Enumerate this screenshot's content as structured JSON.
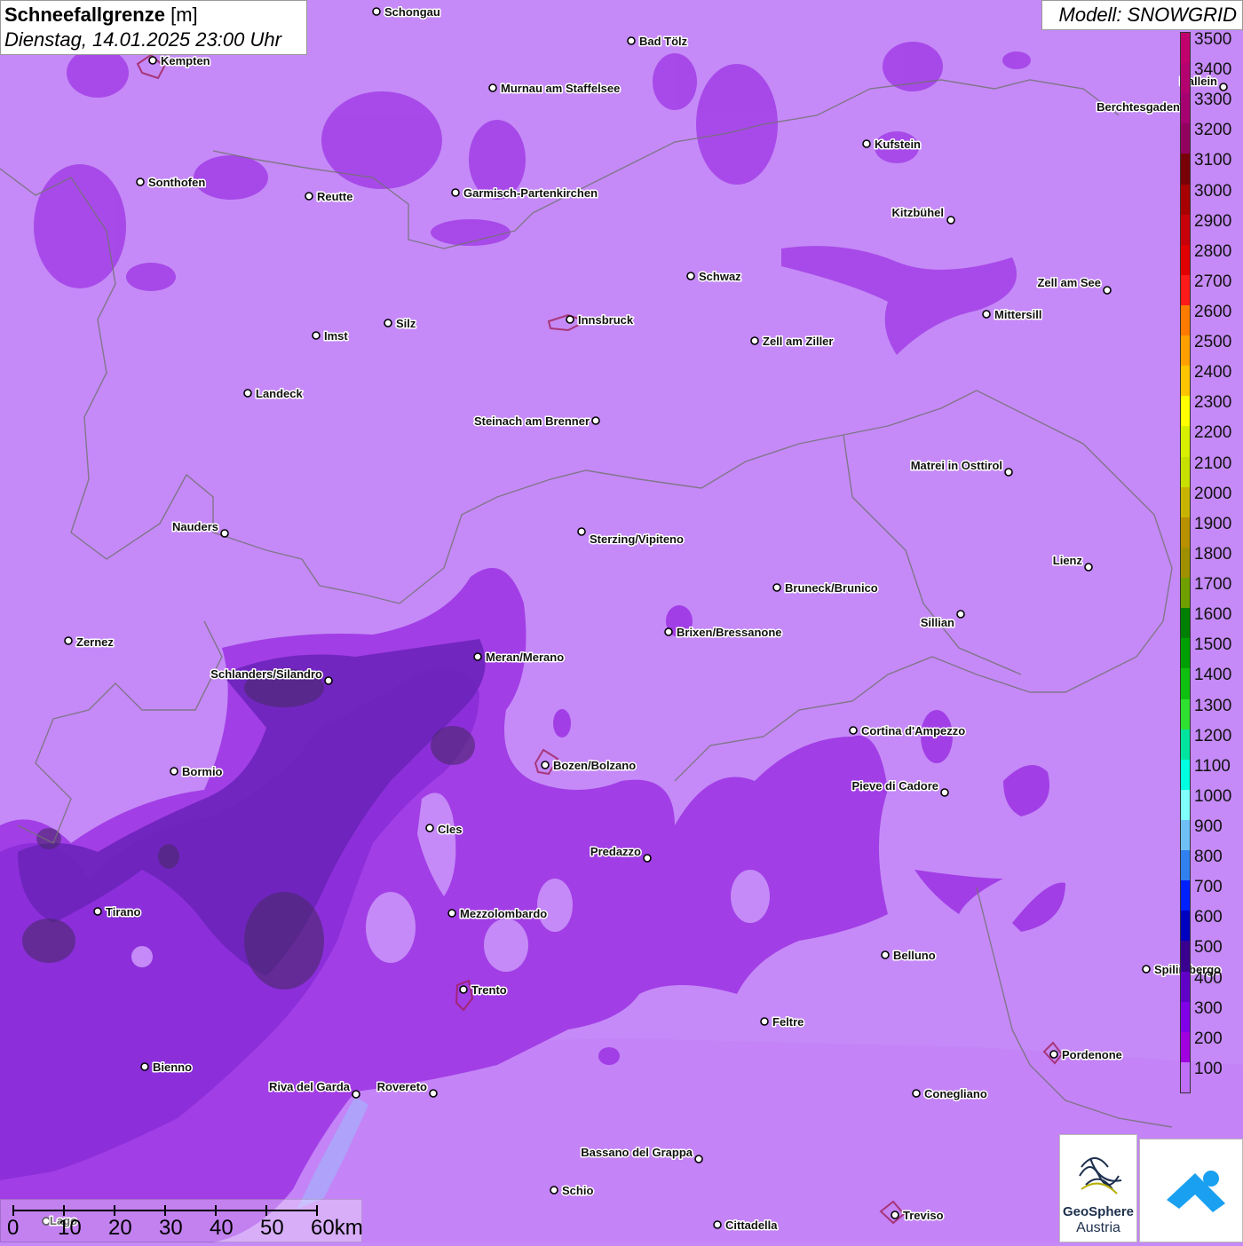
{
  "title": {
    "main": "Schneefallgrenze",
    "unit": "[m]",
    "date": "Dienstag, 14.01.2025 23:00 Uhr"
  },
  "model": "Modell: SNOWGRID",
  "legend": {
    "labels": [
      "3500",
      "3400",
      "3300",
      "3200",
      "3100",
      "3000",
      "2900",
      "2800",
      "2700",
      "2600",
      "2500",
      "2400",
      "2300",
      "2200",
      "2100",
      "2000",
      "1900",
      "1800",
      "1700",
      "1600",
      "1500",
      "1400",
      "1300",
      "1200",
      "1100",
      "1000",
      "900",
      "800",
      "700",
      "600",
      "500",
      "400",
      "300",
      "200",
      "100"
    ],
    "colors": [
      "#c2006d",
      "#b5006f",
      "#a60071",
      "#930060",
      "#7a0008",
      "#a80000",
      "#c8000a",
      "#e00000",
      "#ff1a1a",
      "#ff7a00",
      "#ffa000",
      "#ffc400",
      "#ffff00",
      "#d8f000",
      "#c8e000",
      "#c8b400",
      "#b89000",
      "#a09000",
      "#70a000",
      "#008000",
      "#00a000",
      "#10c010",
      "#30e030",
      "#00e4a0",
      "#00ffe0",
      "#80ffff",
      "#70c0f8",
      "#3080f0",
      "#0020ff",
      "#0000c0",
      "#3a0090",
      "#6000c8",
      "#8000e8",
      "#a000e0",
      "#c070f8"
    ]
  },
  "cities": [
    {
      "name": "Schongau"
    },
    {
      "name": "Bad Tölz"
    },
    {
      "name": "Kempten"
    },
    {
      "name": "Murnau am Staffelsee"
    },
    {
      "name": "Hallein"
    },
    {
      "name": "Berchtesgaden"
    },
    {
      "name": "Kufstein"
    },
    {
      "name": "Sonthofen"
    },
    {
      "name": "Reutte"
    },
    {
      "name": "Garmisch-Partenkirchen"
    },
    {
      "name": "Kitzbühel"
    },
    {
      "name": "Schwaz"
    },
    {
      "name": "Zell am See"
    },
    {
      "name": "Mittersill"
    },
    {
      "name": "Innsbruck"
    },
    {
      "name": "Imst"
    },
    {
      "name": "Silz"
    },
    {
      "name": "Zell am Ziller"
    },
    {
      "name": "Landeck"
    },
    {
      "name": "Steinach am Brenner"
    },
    {
      "name": "Matrei in Osttirol"
    },
    {
      "name": "Nauders"
    },
    {
      "name": "Sterzing/Vipiteno"
    },
    {
      "name": "Lienz"
    },
    {
      "name": "Bruneck/Brunico"
    },
    {
      "name": "Sillian"
    },
    {
      "name": "Brixen/Bressanone"
    },
    {
      "name": "Zernez"
    },
    {
      "name": "Meran/Merano"
    },
    {
      "name": "Schlanders/Silandro"
    },
    {
      "name": "Cortina d'Ampezzo"
    },
    {
      "name": "Bormio"
    },
    {
      "name": "Bozen/Bolzano"
    },
    {
      "name": "Pieve di Cadore"
    },
    {
      "name": "Cles"
    },
    {
      "name": "Predazzo"
    },
    {
      "name": "Tirano"
    },
    {
      "name": "Mezzolombardo"
    },
    {
      "name": "Belluno"
    },
    {
      "name": "Spilimbergo"
    },
    {
      "name": "Trento"
    },
    {
      "name": "Feltre"
    },
    {
      "name": "Pordenone"
    },
    {
      "name": "Bienno"
    },
    {
      "name": "Riva del Garda"
    },
    {
      "name": "Rovereto"
    },
    {
      "name": "Conegliano"
    },
    {
      "name": "Bassano del Grappa"
    },
    {
      "name": "Schio"
    },
    {
      "name": "Treviso"
    },
    {
      "name": "Cittadella"
    },
    {
      "name": "Lago"
    }
  ],
  "scalebar": {
    "labels": [
      "0",
      "10",
      "20",
      "30",
      "40",
      "50",
      "60km"
    ]
  },
  "logos": {
    "geosphere_line1": "GeoSphere",
    "geosphere_line2": "Austria"
  }
}
